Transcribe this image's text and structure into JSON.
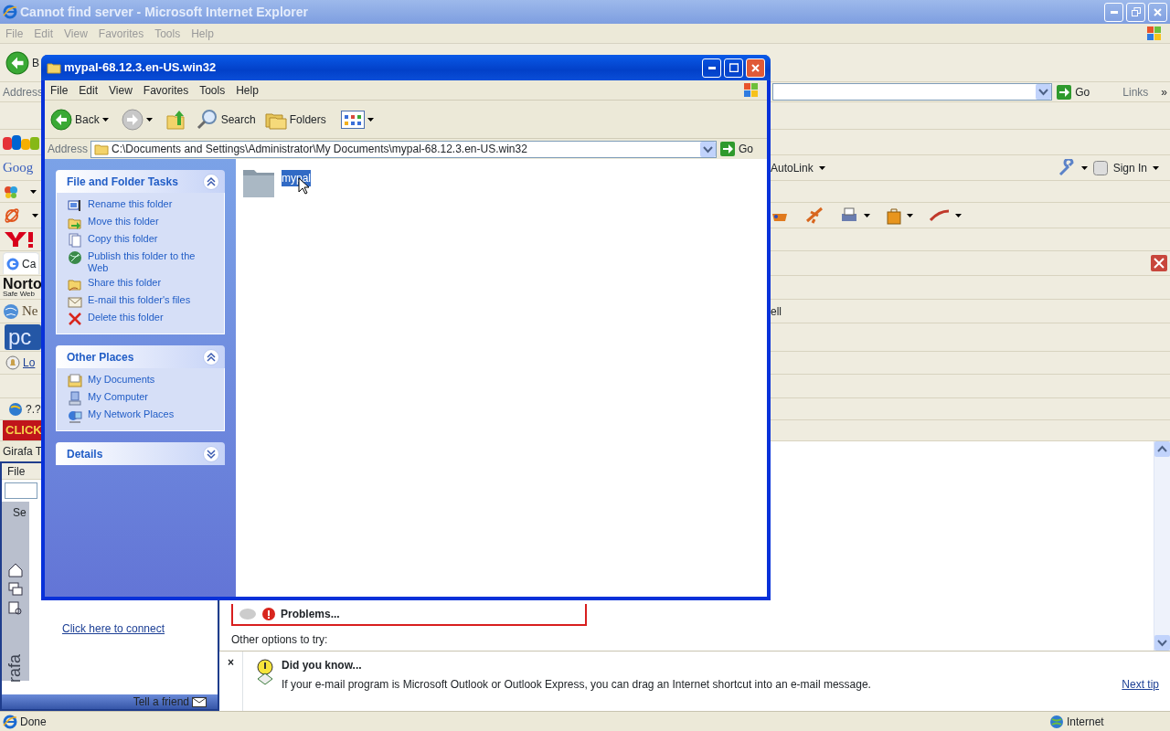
{
  "browser": {
    "title": "Cannot find server - Microsoft Internet Explorer",
    "menu": [
      "File",
      "Edit",
      "View",
      "Favorites",
      "Tools",
      "Help"
    ],
    "back_label": "B",
    "address_label": "Address",
    "go": "Go",
    "links": "Links",
    "more": "»"
  },
  "toolbars": {
    "google": "Goog",
    "autolink": "AutoLink",
    "sign_in": "Sign In",
    "tab": "Ca",
    "norton": "Norto",
    "norton_sub": "Safe Web",
    "news": "Ne",
    "pc": "pc",
    "link": "Lo",
    "tail": "ell",
    "ip": "?.?",
    "banner": "CLICK"
  },
  "sidebar": {
    "header": "Girafa T",
    "menu": "File",
    "tab": "Se",
    "connect": "Click here to connect",
    "brand": "rafa",
    "footer": "Tell a friend"
  },
  "page": {
    "problems": "Problems...",
    "other": "Other options to try:"
  },
  "tip": {
    "close": "×",
    "title": "Did you know...",
    "text": "If your e-mail program is Microsoft Outlook or Outlook Express, you can drag an Internet shortcut into an e-mail message.",
    "next": "Next tip"
  },
  "status_bar": {
    "text": "Done",
    "zone": "Internet"
  },
  "explorer": {
    "title": "mypal-68.12.3.en-US.win32",
    "menu": [
      "File",
      "Edit",
      "View",
      "Favorites",
      "Tools",
      "Help"
    ],
    "toolbar": {
      "back": "Back",
      "search": "Search",
      "folders": "Folders"
    },
    "address_label": "Address",
    "address": "C:\\Documents and Settings\\Administrator\\My Documents\\mypal-68.12.3.en-US.win32",
    "go": "Go",
    "panels": [
      {
        "title": "File and Folder Tasks",
        "expanded": true,
        "items": [
          {
            "label": "Rename this folder",
            "kind": "rename"
          },
          {
            "label": "Move this folder",
            "kind": "move"
          },
          {
            "label": "Copy this folder",
            "kind": "copy"
          },
          {
            "label": "Publish this folder to the Web",
            "kind": "publish"
          },
          {
            "label": "Share this folder",
            "kind": "share"
          },
          {
            "label": "E-mail this folder's files",
            "kind": "email"
          },
          {
            "label": "Delete this folder",
            "kind": "delete"
          }
        ]
      },
      {
        "title": "Other Places",
        "expanded": true,
        "items": [
          {
            "label": "My Documents",
            "kind": "documents"
          },
          {
            "label": "My Computer",
            "kind": "computer"
          },
          {
            "label": "My Network Places",
            "kind": "network"
          }
        ]
      },
      {
        "title": "Details",
        "expanded": false
      }
    ],
    "files": [
      {
        "name": "mypal",
        "selected": true
      }
    ]
  }
}
